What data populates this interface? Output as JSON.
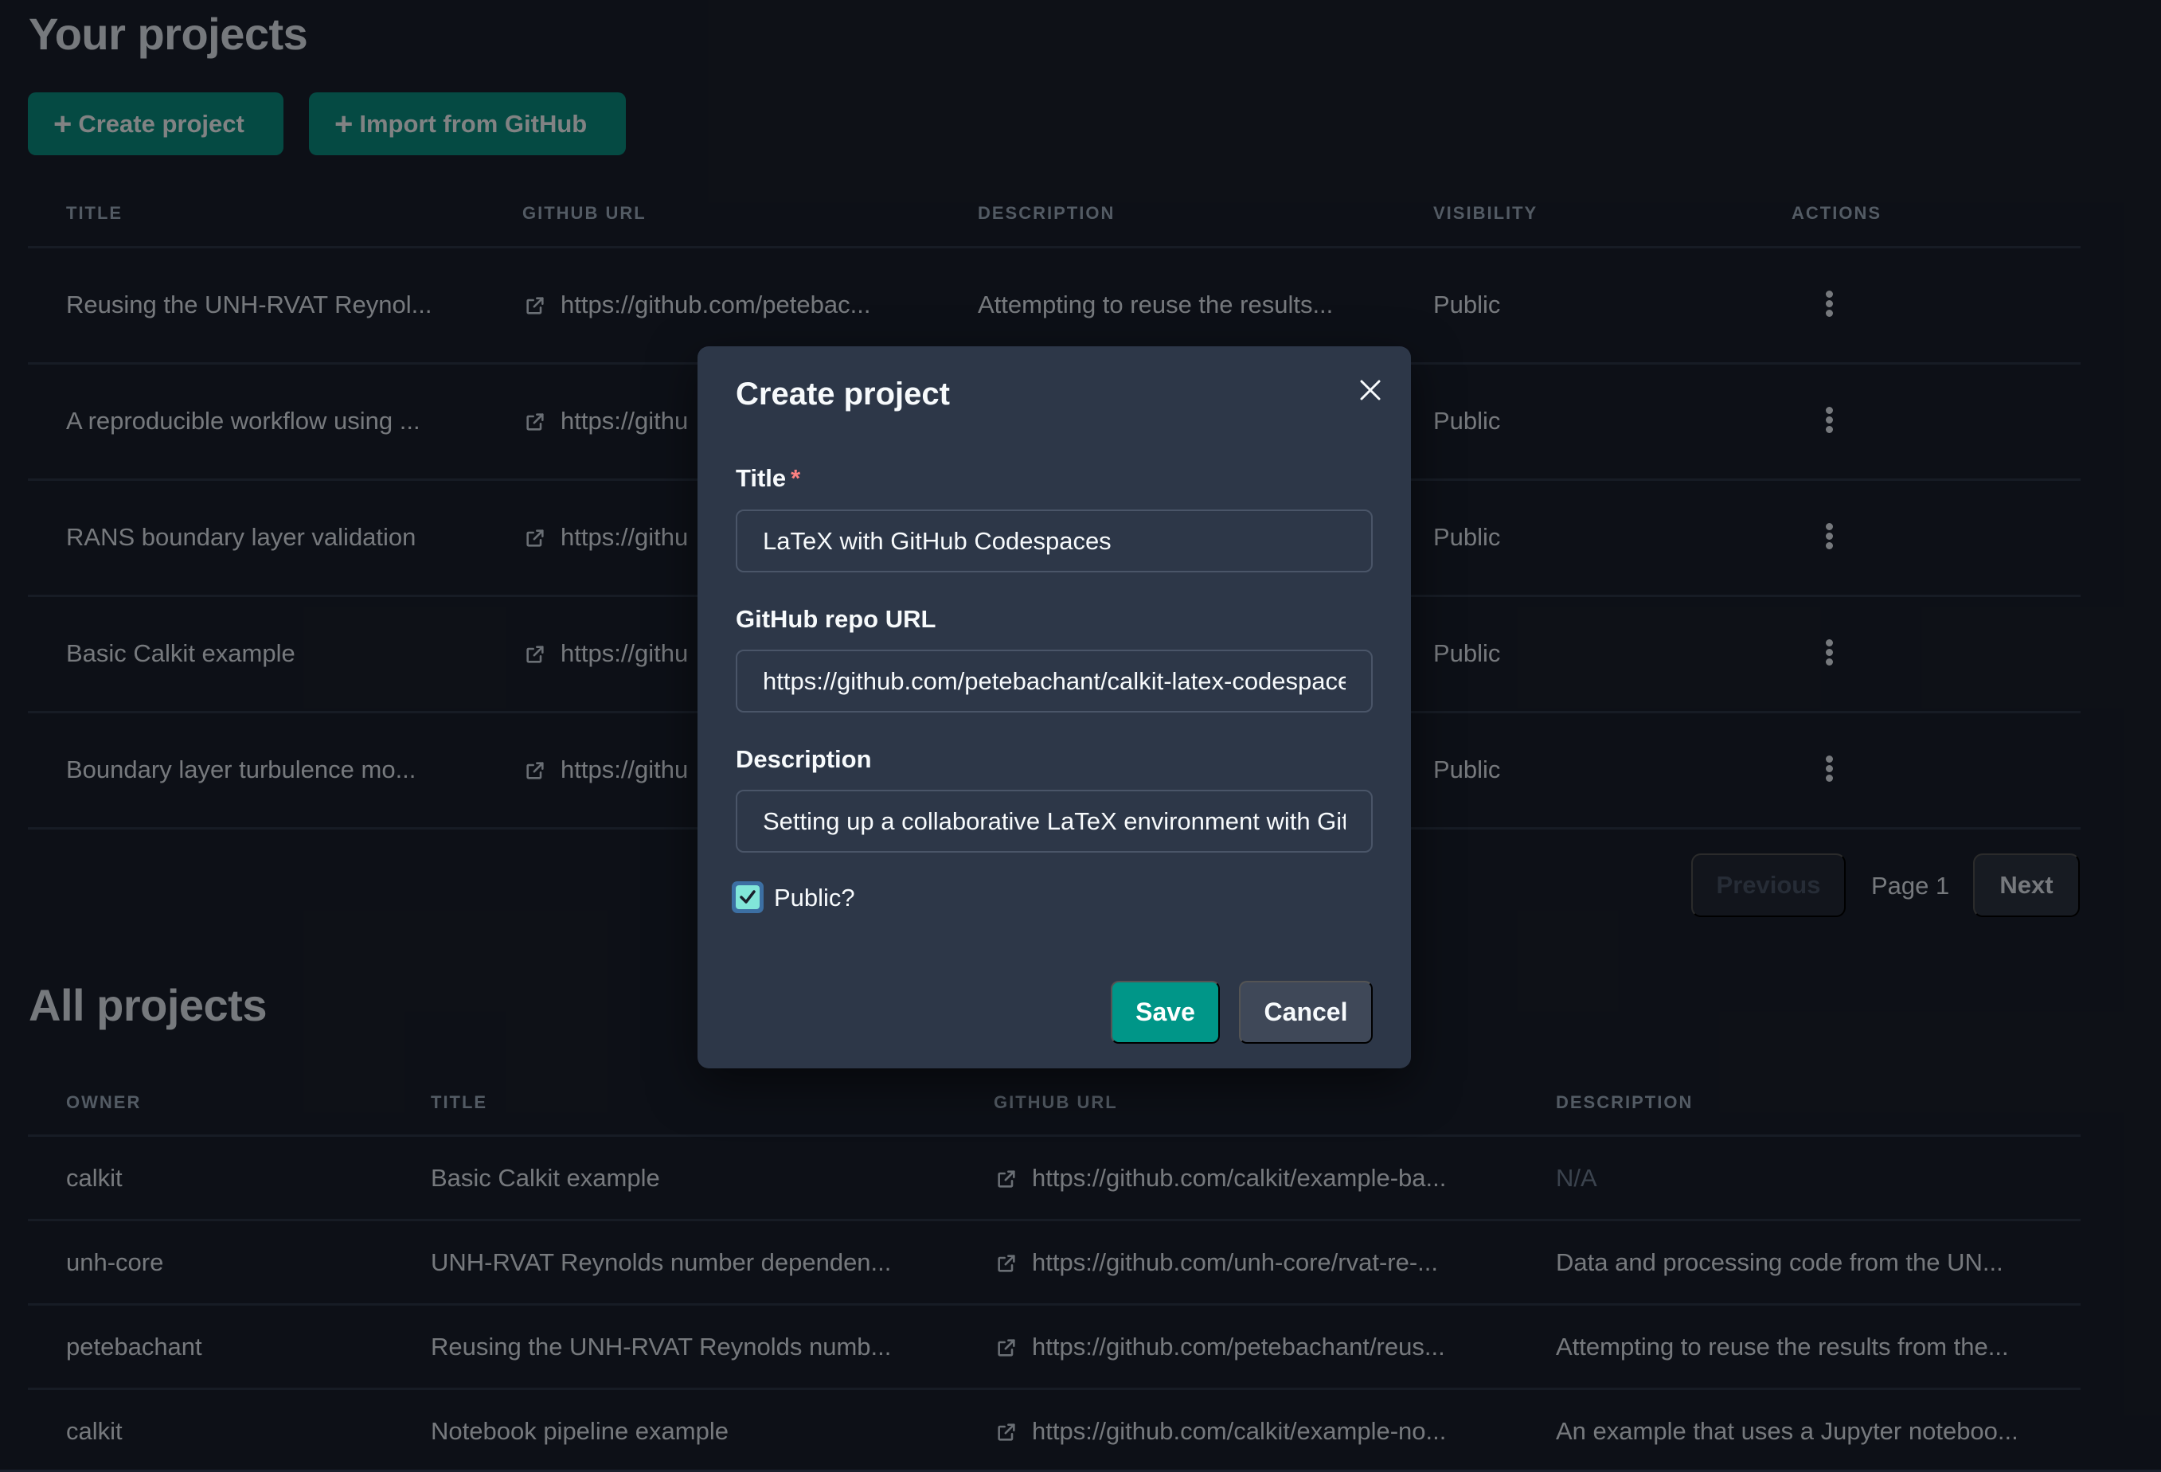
{
  "your_projects": {
    "heading": "Your projects",
    "create_button": "Create project",
    "import_button": "Import from GitHub",
    "columns": [
      "Title",
      "GitHub URL",
      "Description",
      "Visibility",
      "Actions"
    ],
    "rows": [
      {
        "title": "Reusing the UNH-RVAT Reynol...",
        "github_url": "https://github.com/petebac...",
        "description": "Attempting to reuse the results...",
        "visibility": "Public"
      },
      {
        "title": "A reproducible workflow using ...",
        "github_url": "https://githu",
        "description": "",
        "visibility": "Public"
      },
      {
        "title": "RANS boundary layer validation",
        "github_url": "https://githu",
        "description": "",
        "visibility": "Public"
      },
      {
        "title": "Basic Calkit example",
        "github_url": "https://githu",
        "description": "",
        "visibility": "Public"
      },
      {
        "title": "Boundary layer turbulence mo...",
        "github_url": "https://githu",
        "description": "",
        "visibility": "Public"
      }
    ],
    "pagination": {
      "previous": "Previous",
      "page_label": "Page 1",
      "next": "Next"
    }
  },
  "all_projects": {
    "heading": "All projects",
    "columns": [
      "Owner",
      "Title",
      "GitHub URL",
      "Description"
    ],
    "rows": [
      {
        "owner": "calkit",
        "title": "Basic Calkit example",
        "github_url": "https://github.com/calkit/example-ba...",
        "description": "N/A"
      },
      {
        "owner": "unh-core",
        "title": "UNH-RVAT Reynolds number dependen...",
        "github_url": "https://github.com/unh-core/rvat-re-...",
        "description": "Data and processing code from the UN..."
      },
      {
        "owner": "petebachant",
        "title": "Reusing the UNH-RVAT Reynolds numb...",
        "github_url": "https://github.com/petebachant/reus...",
        "description": "Attempting to reuse the results from the..."
      },
      {
        "owner": "calkit",
        "title": "Notebook pipeline example",
        "github_url": "https://github.com/calkit/example-no...",
        "description": "An example that uses a Jupyter noteboo..."
      }
    ]
  },
  "modal": {
    "title": "Create project",
    "fields": {
      "title_label": "Title",
      "required_marker": "*",
      "title_value": "LaTeX with GitHub Codespaces",
      "repo_label": "GitHub repo URL",
      "repo_value": "https://github.com/petebachant/calkit-latex-codespaces",
      "description_label": "Description",
      "description_value": "Setting up a collaborative LaTeX environment with GitHub Codespaces",
      "public_label": "Public?",
      "public_checked": true
    },
    "save_button": "Save",
    "cancel_button": "Cancel"
  },
  "colors": {
    "accent_teal": "#009688",
    "button_teal": "#0a8f80",
    "checkbox_fill": "#81e6d9",
    "required": "#fc8181",
    "modal_bg": "#2d3748",
    "page_bg": "#1a202c"
  },
  "icons": {
    "external_link": "external-link-icon",
    "kebab": "more-vertical-icon",
    "close": "close-icon",
    "plus": "plus-icon",
    "check": "checkmark-icon"
  }
}
